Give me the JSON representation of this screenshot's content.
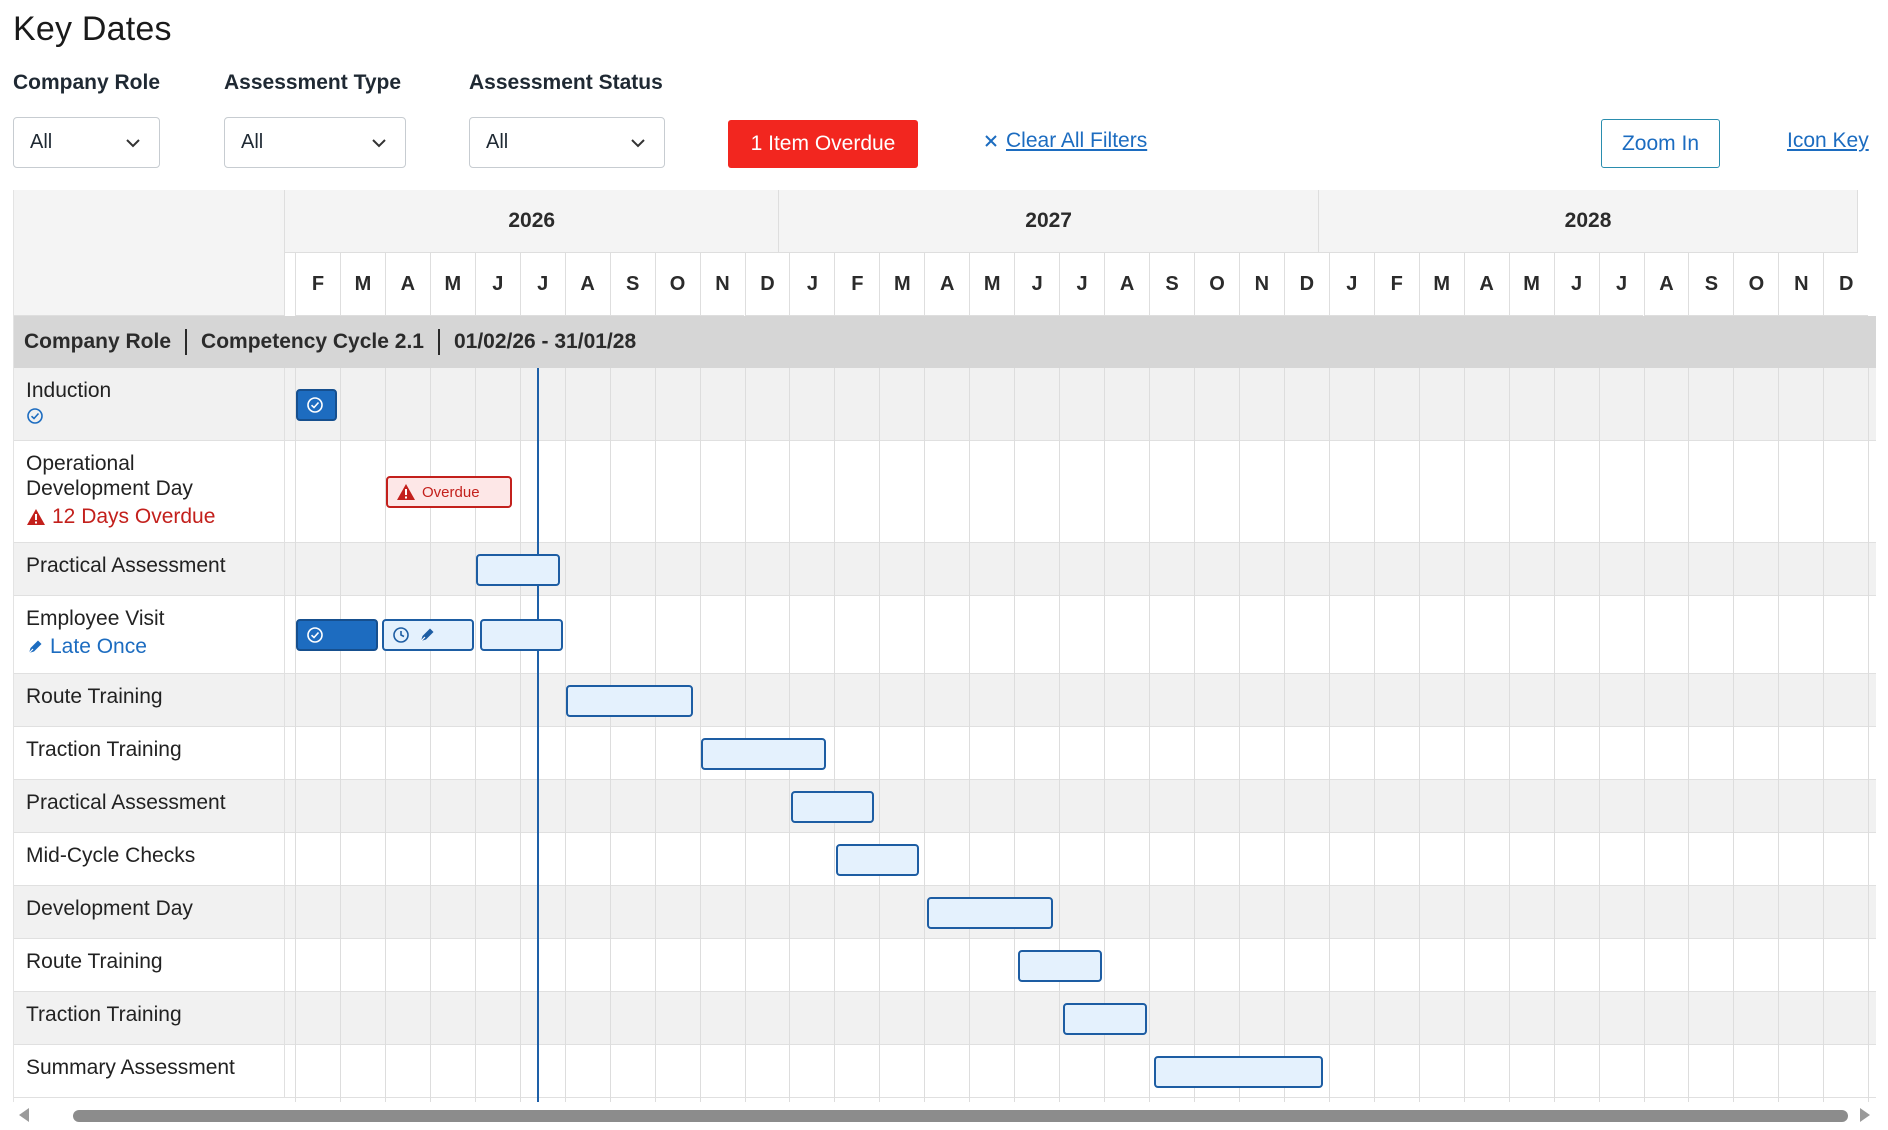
{
  "page": {
    "title": "Key Dates"
  },
  "filters": {
    "company_role": {
      "label": "Company Role",
      "value": "All"
    },
    "assessment_type": {
      "label": "Assessment Type",
      "value": "All"
    },
    "assessment_status": {
      "label": "Assessment Status",
      "value": "All"
    },
    "overdue_button": "1 Item Overdue",
    "clear_all": "Clear All Filters",
    "zoom_in": "Zoom In",
    "icon_key": "Icon Key"
  },
  "timeline": {
    "years": [
      "2026",
      "2027",
      "2028"
    ],
    "months": [
      "F",
      "M",
      "A",
      "M",
      "J",
      "J",
      "A",
      "S",
      "O",
      "N",
      "D",
      "J",
      "F",
      "M",
      "A",
      "M",
      "J",
      "J",
      "A",
      "S",
      "O",
      "N",
      "D",
      "J",
      "F",
      "M",
      "A",
      "M",
      "J",
      "J",
      "A",
      "S",
      "O",
      "N",
      "D"
    ],
    "today_month_index": 5.4
  },
  "group": {
    "role": "Company Role",
    "cycle": "Competency Cycle 2.1",
    "dates": "01/02/26 - 31/01/28"
  },
  "rows": [
    {
      "label": "Induction",
      "sub_icon": "check-circle-icon"
    },
    {
      "label": "Operational Development Day",
      "sub_text": "12 Days Overdue",
      "sub_icon": "warning-icon"
    },
    {
      "label": "Practical Assessment"
    },
    {
      "label": "Employee Visit",
      "sub_text": "Late Once",
      "sub_icon": "pen-icon"
    },
    {
      "label": "Route Training"
    },
    {
      "label": "Traction Training"
    },
    {
      "label": "Practical Assessment"
    },
    {
      "label": "Mid-Cycle Checks"
    },
    {
      "label": "Development Day"
    },
    {
      "label": "Route Training"
    },
    {
      "label": "Traction Training"
    },
    {
      "label": "Summary Assessment"
    }
  ],
  "bar_labels": {
    "overdue": "Overdue"
  },
  "colors": {
    "accent_blue": "#1d6cc0",
    "bar_fill": "#e4f1fd",
    "overdue_red": "#f2261f",
    "today_line": "#1e60a8"
  }
}
